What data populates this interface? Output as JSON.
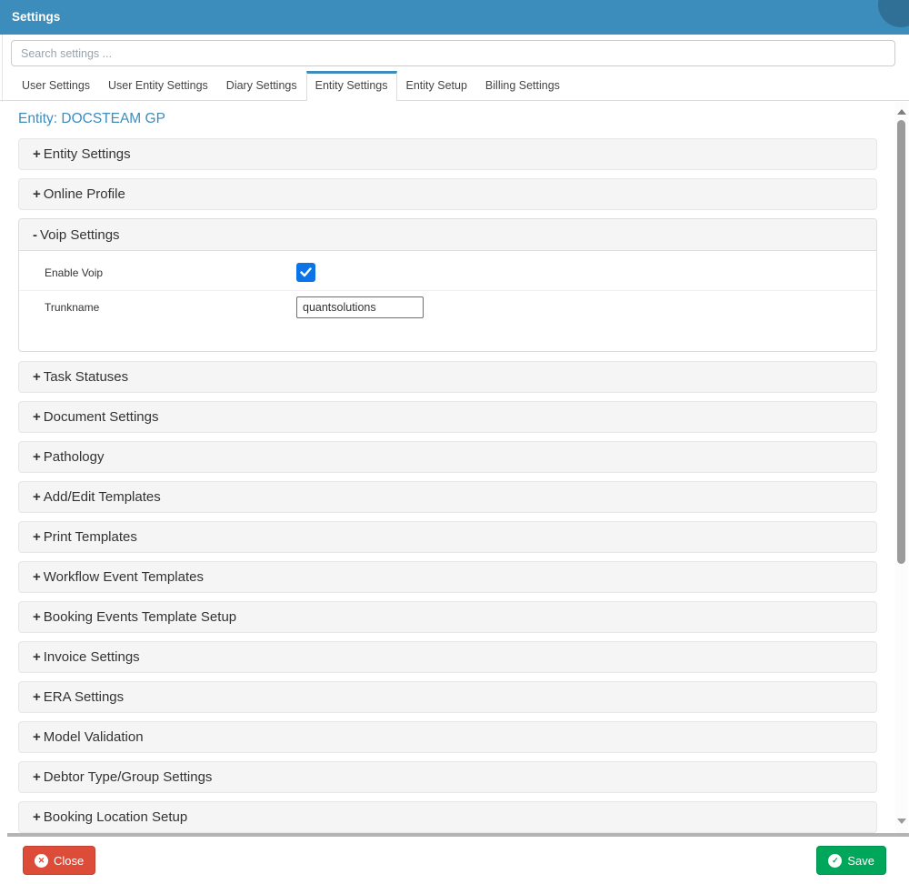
{
  "header": {
    "title": "Settings"
  },
  "search": {
    "placeholder": "Search settings ..."
  },
  "tabs": [
    {
      "label": "User Settings",
      "active": false
    },
    {
      "label": "User Entity Settings",
      "active": false
    },
    {
      "label": "Diary Settings",
      "active": false
    },
    {
      "label": "Entity Settings",
      "active": true
    },
    {
      "label": "Entity Setup",
      "active": false
    },
    {
      "label": "Billing Settings",
      "active": false
    }
  ],
  "entity_heading": "Entity: DOCSTEAM GP",
  "panels": [
    {
      "label": "Entity Settings",
      "sign": "+",
      "expanded": false
    },
    {
      "label": "Online Profile",
      "sign": "+",
      "expanded": false
    },
    {
      "label": "Voip Settings",
      "sign": "-",
      "expanded": true
    },
    {
      "label": "Task Statuses",
      "sign": "+",
      "expanded": false
    },
    {
      "label": "Document Settings",
      "sign": "+",
      "expanded": false
    },
    {
      "label": "Pathology",
      "sign": "+",
      "expanded": false
    },
    {
      "label": "Add/Edit Templates",
      "sign": "+",
      "expanded": false
    },
    {
      "label": "Print Templates",
      "sign": "+",
      "expanded": false
    },
    {
      "label": "Workflow Event Templates",
      "sign": "+",
      "expanded": false
    },
    {
      "label": "Booking Events Template Setup",
      "sign": "+",
      "expanded": false
    },
    {
      "label": "Invoice Settings",
      "sign": "+",
      "expanded": false
    },
    {
      "label": "ERA Settings",
      "sign": "+",
      "expanded": false
    },
    {
      "label": "Model Validation",
      "sign": "+",
      "expanded": false
    },
    {
      "label": "Debtor Type/Group Settings",
      "sign": "+",
      "expanded": false
    },
    {
      "label": "Booking Location Setup",
      "sign": "+",
      "expanded": false
    }
  ],
  "voip": {
    "enable_label": "Enable Voip",
    "enabled": true,
    "trunkname_label": "Trunkname",
    "trunkname_value": "quantsolutions"
  },
  "footer": {
    "close_label": "Close",
    "close_icon": "✕",
    "save_label": "Save",
    "save_icon": "✓"
  },
  "colors": {
    "header_blue": "#3c8dbc",
    "link_blue": "#3c8dbc",
    "close_red": "#dd4b39",
    "save_green": "#00a65a",
    "checkbox_blue": "#0d74e7",
    "panel_bg": "#f5f5f5"
  }
}
